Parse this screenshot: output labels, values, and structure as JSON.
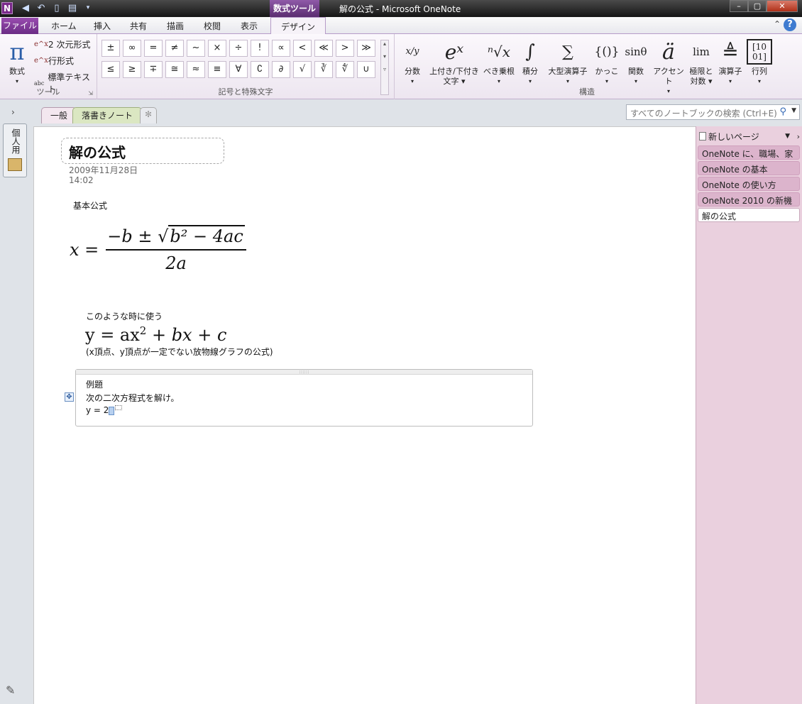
{
  "window": {
    "title": "解の公式 - Microsoft OneNote",
    "context_tab_group": "数式ツール",
    "logo_letter": "N"
  },
  "ribbon_tabs": [
    "ファイル",
    "ホーム",
    "挿入",
    "共有",
    "描画",
    "校閲",
    "表示",
    "デザイン"
  ],
  "active_tab": "デザイン",
  "tools_group": {
    "label": "ツール",
    "equation_label": "数式",
    "equation_glyph": "π",
    "small_buttons": [
      "2 次元形式",
      "行形式",
      "標準テキスト"
    ],
    "small_icons": [
      "e^x",
      "e^x",
      "abc"
    ]
  },
  "symbols_group": {
    "label": "記号と特殊文字",
    "row1": [
      "±",
      "∞",
      "=",
      "≠",
      "~",
      "×",
      "÷",
      "!",
      "∝",
      "<",
      "≪",
      ">",
      "≫"
    ],
    "row2": [
      "≤",
      "≥",
      "∓",
      "≅",
      "≈",
      "≡",
      "∀",
      "∁",
      "∂",
      "√",
      "∛",
      "∜",
      "∪"
    ]
  },
  "structures_group": {
    "label": "構造",
    "buttons": [
      {
        "glyph": "x/y",
        "label": "分数"
      },
      {
        "glyph": "eˣ",
        "label": "上付き/下付き",
        "label2": "文字"
      },
      {
        "glyph": "ⁿ√x",
        "label": "べき乗根"
      },
      {
        "glyph": "∫",
        "label": "積分"
      },
      {
        "glyph": "∑",
        "label": "大型演算子"
      },
      {
        "glyph": "{()}",
        "label": "かっこ"
      },
      {
        "glyph": "sinθ",
        "label": "関数"
      },
      {
        "glyph": "ä",
        "label": "アクセント"
      },
      {
        "glyph": "lim",
        "label": "極限と",
        "label2": "対数"
      },
      {
        "glyph": "≜",
        "label": "演算子"
      },
      {
        "glyph": "[10 01]",
        "label": "行列"
      }
    ]
  },
  "sections": [
    "一般",
    "落書きノート"
  ],
  "active_section": "一般",
  "search": {
    "placeholder": "すべてのノートブックの検索 (Ctrl+E)"
  },
  "notebook": {
    "name": "個人用"
  },
  "page": {
    "title": "解の公式",
    "date": "2009年11月28日",
    "time": "14:02",
    "heading": "基本公式",
    "formula": {
      "lhs": "x =",
      "numerator": "−b ± ",
      "radicand": "b² − 4ac",
      "denominator": "2a"
    },
    "usage_label": "このような時に使う",
    "usage_eq": {
      "a": "y = ax",
      "exp": "2",
      "b": " + bx + c"
    },
    "usage_note": "(x頂点、y頂点が一定でない放物線グラフの公式)",
    "example": {
      "title": "例題",
      "line1": "次の二次方程式を解け。",
      "line2": "y = 2"
    }
  },
  "page_list": {
    "new_page": "新しいページ",
    "items": [
      "OneNote に、職場、家",
      "OneNote の基本",
      "OneNote の使い方",
      "OneNote 2010 の新機",
      "解の公式"
    ],
    "active_index": 4
  },
  "colors": {
    "accent": "#7a2a8a",
    "file_tab": "#8a3fa3",
    "page_list_bg": "#ead0de",
    "section_general": "#f3e7ef",
    "section_scribble": "#dbe7c2"
  }
}
